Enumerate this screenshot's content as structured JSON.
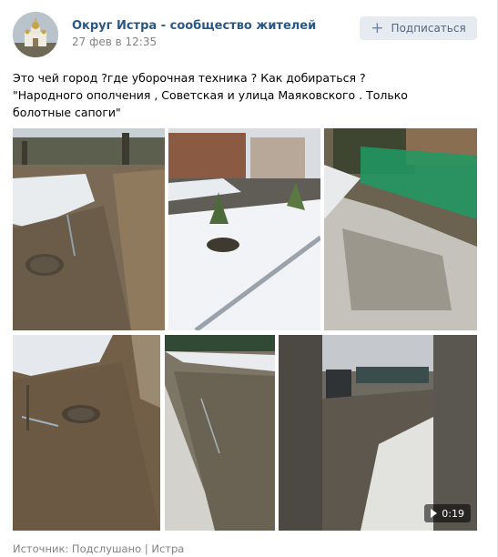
{
  "post": {
    "group_name": "Округ Истра - сообщество жителей",
    "date": "27 фев в 12:35",
    "subscribe_label": "Подписаться",
    "text_lines": [
      "Это чей город ?где уборочная техника ? Как добираться ?",
      "\"Народного ополчения , Советская и улица Маяковского . Только болотные сапоги\""
    ],
    "video_duration": "0:19",
    "source": "Источник: Подслушано | Истра"
  },
  "icons": {
    "avatar": "church-avatar-icon",
    "subscribe": "plus-icon",
    "video": "play-icon"
  },
  "colors": {
    "link": "#2a5885",
    "meta": "#828282",
    "button_bg": "#e5ebf1"
  }
}
